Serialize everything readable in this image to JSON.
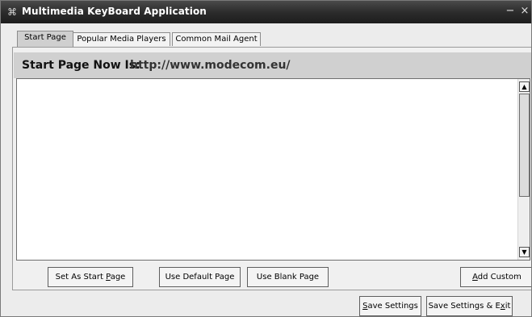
{
  "window": {
    "title": "Multimedia KeyBoard Application",
    "title_icon": "keyboard-app-icon",
    "minimize_glyph": "−",
    "close_glyph": "×"
  },
  "tabs": [
    {
      "label": "Start Page",
      "active": true
    },
    {
      "label": "Popular Media Players",
      "active": false
    },
    {
      "label": "Common Mail Agent",
      "active": false
    }
  ],
  "start_page": {
    "label": "Start Page Now Is:",
    "url": "http://www.modecom.eu/"
  },
  "buttons": {
    "set_as_start_pre": "Set As Start ",
    "set_as_start_accel": "P",
    "set_as_start_post": "age",
    "use_default": "Use Default Page",
    "use_blank": "Use Blank Page",
    "add_custom_accel": "A",
    "add_custom_post": "dd Custom",
    "save_accel": "S",
    "save_post": "ave Settings",
    "save_exit_pre": "Save Settings & E",
    "save_exit_accel": "x",
    "save_exit_post": "it"
  },
  "colors": {
    "titlebar": "#2a2a2a",
    "header_bar": "#d0d0d0",
    "window_bg": "#ececec"
  }
}
